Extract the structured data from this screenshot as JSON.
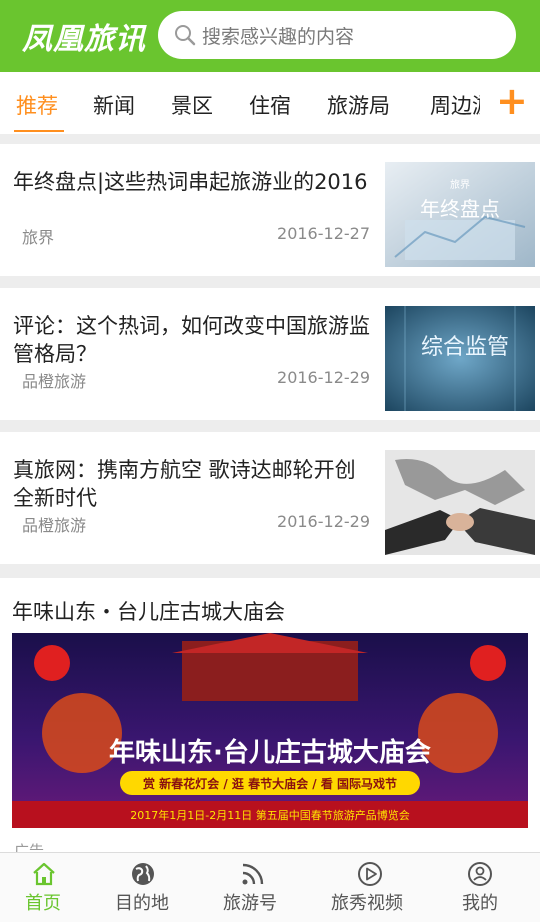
{
  "header": {
    "logo": "凤凰旅讯",
    "search_placeholder": "搜索感兴趣的内容"
  },
  "tabs": [
    {
      "label": "推荐",
      "active": true
    },
    {
      "label": "新闻",
      "active": false
    },
    {
      "label": "景区",
      "active": false
    },
    {
      "label": "住宿",
      "active": false
    },
    {
      "label": "旅游局",
      "active": false
    },
    {
      "label": "周边游",
      "active": false
    }
  ],
  "add_channel_label": "+",
  "articles": [
    {
      "title": "年终盘点|这些热词串起旅游业的2016",
      "source": "旅界",
      "date": "2016-12-27",
      "thumb_text_small": "旅界",
      "thumb_text": "年终盘点"
    },
    {
      "title": "评论：这个热词，如何改变中国旅游监管格局？",
      "source": "品橙旅游",
      "date": "2016-12-29",
      "thumb_text": "综合监管"
    },
    {
      "title": "真旅网：携南方航空 歌诗达邮轮开创全新时代",
      "source": "品橙旅游",
      "date": "2016-12-29"
    }
  ],
  "ad": {
    "title": "年味山东・台儿庄古城大庙会",
    "banner_headline": "年味山东·台儿庄古城大庙会",
    "banner_sub": "赏 新春花灯会 / 逛 春节大庙会 / 看 国际马戏节",
    "banner_date": "2017年1月1日-2月11日  第五届中国春节旅游产品博览会",
    "label": "广告"
  },
  "bottom_nav": [
    {
      "label": "首页",
      "icon": "home-icon",
      "active": true
    },
    {
      "label": "目的地",
      "icon": "globe-icon",
      "active": false
    },
    {
      "label": "旅游号",
      "icon": "rss-icon",
      "active": false
    },
    {
      "label": "旅秀视频",
      "icon": "play-icon",
      "active": false
    },
    {
      "label": "我的",
      "icon": "user-icon",
      "active": false
    }
  ],
  "colors": {
    "brand_green": "#6ac52f",
    "accent_orange": "#ff8f1f"
  }
}
